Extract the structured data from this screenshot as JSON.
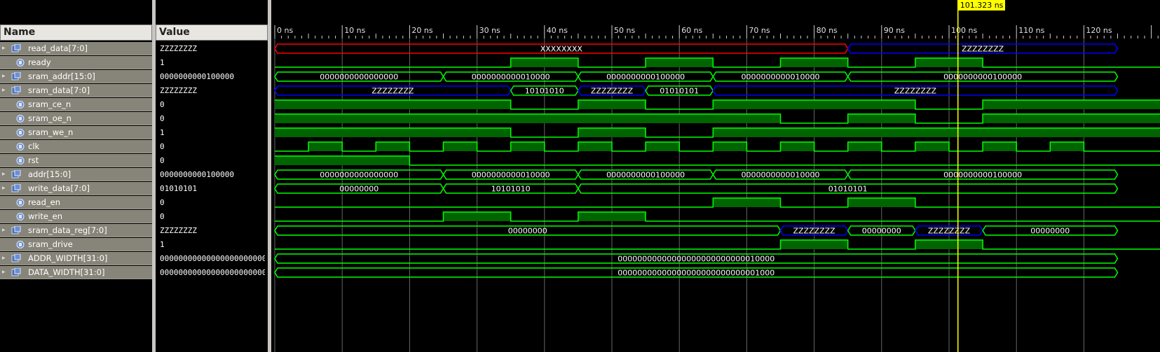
{
  "headers": {
    "name": "Name",
    "value": "Value"
  },
  "cursor": {
    "label": "101.323 ns",
    "time": 101.323
  },
  "timeline": {
    "ticks": [
      "0 ns",
      "10 ns",
      "20 ns",
      "30 ns",
      "40 ns",
      "50 ns",
      "60 ns",
      "70 ns",
      "80 ns",
      "90 ns",
      "100 ns",
      "110 ns",
      "120 ns"
    ],
    "tick_times": [
      0,
      10,
      20,
      30,
      40,
      50,
      60,
      70,
      80,
      90,
      100,
      110,
      120
    ]
  },
  "colors": {
    "wave": "#00ff00",
    "fill": "#006400",
    "bus_z": "#0000ff",
    "bus_x": "#ff0000",
    "cursor": "#ffff00",
    "grid": "#aaaaaa"
  },
  "signals": [
    {
      "name": "read_data[7:0]",
      "value": "ZZZZZZZZ",
      "type": "bus",
      "segments": [
        {
          "start": 0,
          "end": 85,
          "label": "XXXXXXXX",
          "style": "x"
        },
        {
          "start": 85,
          "end": 125,
          "label": "ZZZZZZZZ",
          "style": "z"
        }
      ]
    },
    {
      "name": "ready",
      "value": "1",
      "type": "bit",
      "edges": [
        [
          0,
          0
        ],
        [
          35,
          1
        ],
        [
          45,
          0
        ],
        [
          55,
          1
        ],
        [
          65,
          0
        ],
        [
          75,
          1
        ],
        [
          85,
          0
        ],
        [
          95,
          1
        ],
        [
          105,
          0
        ]
      ]
    },
    {
      "name": "sram_addr[15:0]",
      "value": "0000000000100000",
      "type": "bus",
      "segments": [
        {
          "start": 0,
          "end": 25,
          "label": "0000000000000000"
        },
        {
          "start": 25,
          "end": 45,
          "label": "0000000000010000"
        },
        {
          "start": 45,
          "end": 65,
          "label": "0000000000100000"
        },
        {
          "start": 65,
          "end": 85,
          "label": "0000000000010000"
        },
        {
          "start": 85,
          "end": 125,
          "label": "0000000000100000"
        }
      ]
    },
    {
      "name": "sram_data[7:0]",
      "value": "ZZZZZZZZ",
      "type": "bus",
      "segments": [
        {
          "start": 0,
          "end": 35,
          "label": "ZZZZZZZZ",
          "style": "z"
        },
        {
          "start": 35,
          "end": 45,
          "label": "10101010"
        },
        {
          "start": 45,
          "end": 55,
          "label": "ZZZZZZZZ",
          "style": "z"
        },
        {
          "start": 55,
          "end": 65,
          "label": "01010101"
        },
        {
          "start": 65,
          "end": 125,
          "label": "ZZZZZZZZ",
          "style": "z"
        }
      ]
    },
    {
      "name": "sram_ce_n",
      "value": "0",
      "type": "bit",
      "edges": [
        [
          0,
          1
        ],
        [
          35,
          0
        ],
        [
          45,
          1
        ],
        [
          55,
          0
        ],
        [
          65,
          1
        ],
        [
          95,
          0
        ],
        [
          105,
          1
        ]
      ]
    },
    {
      "name": "sram_oe_n",
      "value": "0",
      "type": "bit",
      "edges": [
        [
          0,
          1
        ],
        [
          75,
          0
        ],
        [
          85,
          1
        ],
        [
          95,
          0
        ],
        [
          105,
          1
        ]
      ]
    },
    {
      "name": "sram_we_n",
      "value": "1",
      "type": "bit",
      "edges": [
        [
          0,
          1
        ],
        [
          35,
          0
        ],
        [
          45,
          1
        ],
        [
          55,
          0
        ],
        [
          65,
          1
        ]
      ]
    },
    {
      "name": "clk",
      "value": "0",
      "type": "bit",
      "edges": [
        [
          0,
          0
        ],
        [
          5,
          1
        ],
        [
          10,
          0
        ],
        [
          15,
          1
        ],
        [
          20,
          0
        ],
        [
          25,
          1
        ],
        [
          30,
          0
        ],
        [
          35,
          1
        ],
        [
          40,
          0
        ],
        [
          45,
          1
        ],
        [
          50,
          0
        ],
        [
          55,
          1
        ],
        [
          60,
          0
        ],
        [
          65,
          1
        ],
        [
          70,
          0
        ],
        [
          75,
          1
        ],
        [
          80,
          0
        ],
        [
          85,
          1
        ],
        [
          90,
          0
        ],
        [
          95,
          1
        ],
        [
          100,
          0
        ],
        [
          105,
          1
        ],
        [
          110,
          0
        ],
        [
          115,
          1
        ],
        [
          120,
          0
        ]
      ]
    },
    {
      "name": "rst",
      "value": "0",
      "type": "bit",
      "edges": [
        [
          0,
          1
        ],
        [
          20,
          0
        ]
      ]
    },
    {
      "name": "addr[15:0]",
      "value": "0000000000100000",
      "type": "bus",
      "segments": [
        {
          "start": 0,
          "end": 25,
          "label": "0000000000000000"
        },
        {
          "start": 25,
          "end": 45,
          "label": "0000000000010000"
        },
        {
          "start": 45,
          "end": 65,
          "label": "0000000000100000"
        },
        {
          "start": 65,
          "end": 85,
          "label": "0000000000010000"
        },
        {
          "start": 85,
          "end": 125,
          "label": "0000000000100000"
        }
      ]
    },
    {
      "name": "write_data[7:0]",
      "value": "01010101",
      "type": "bus",
      "segments": [
        {
          "start": 0,
          "end": 25,
          "label": "00000000"
        },
        {
          "start": 25,
          "end": 45,
          "label": "10101010"
        },
        {
          "start": 45,
          "end": 125,
          "label": "01010101"
        }
      ]
    },
    {
      "name": "read_en",
      "value": "0",
      "type": "bit",
      "edges": [
        [
          0,
          0
        ],
        [
          65,
          1
        ],
        [
          75,
          0
        ],
        [
          85,
          1
        ],
        [
          95,
          0
        ]
      ]
    },
    {
      "name": "write_en",
      "value": "0",
      "type": "bit",
      "edges": [
        [
          0,
          0
        ],
        [
          25,
          1
        ],
        [
          35,
          0
        ],
        [
          45,
          1
        ],
        [
          55,
          0
        ]
      ]
    },
    {
      "name": "sram_data_reg[7:0]",
      "value": "ZZZZZZZZ",
      "type": "bus",
      "segments": [
        {
          "start": 0,
          "end": 75,
          "label": "00000000"
        },
        {
          "start": 75,
          "end": 85,
          "label": "ZZZZZZZZ",
          "style": "z"
        },
        {
          "start": 85,
          "end": 95,
          "label": "00000000"
        },
        {
          "start": 95,
          "end": 105,
          "label": "ZZZZZZZZ",
          "style": "z"
        },
        {
          "start": 105,
          "end": 125,
          "label": "00000000"
        }
      ]
    },
    {
      "name": "sram_drive",
      "value": "1",
      "type": "bit",
      "edges": [
        [
          0,
          0
        ],
        [
          75,
          1
        ],
        [
          85,
          0
        ],
        [
          95,
          1
        ],
        [
          105,
          0
        ]
      ]
    },
    {
      "name": "ADDR_WIDTH[31:0]",
      "value": "00000000000000000000000000010000",
      "type": "bus",
      "segments": [
        {
          "start": 0,
          "end": 125,
          "label": "00000000000000000000000000010000"
        }
      ]
    },
    {
      "name": "DATA_WIDTH[31:0]",
      "value": "00000000000000000000000000001000",
      "type": "bus",
      "segments": [
        {
          "start": 0,
          "end": 125,
          "label": "00000000000000000000000000001000"
        }
      ]
    }
  ]
}
